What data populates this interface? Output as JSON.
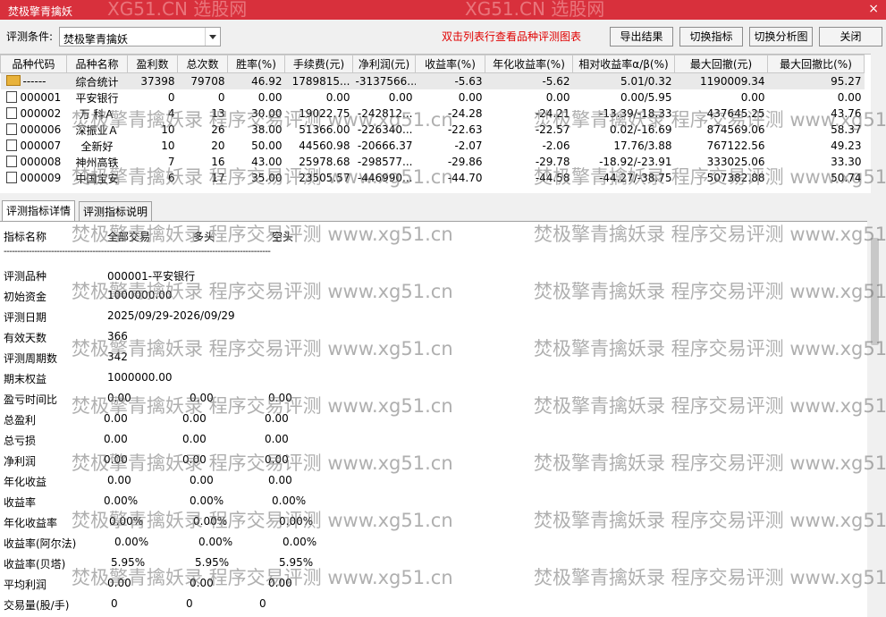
{
  "window": {
    "title": "焚极擎青擒妖",
    "close_label": "×"
  },
  "toolbar": {
    "condition_label": "评测条件:",
    "condition_value": "焚极擎青擒妖",
    "hint": "双击列表行查看品种评测图表",
    "buttons": {
      "export": "导出结果",
      "switch_indicator": "切换指标",
      "switch_chart": "切换分析图",
      "close": "关闭"
    }
  },
  "grid": {
    "columns": [
      "品种代码",
      "品种名称",
      "盈利数",
      "总次数",
      "胜率(%)",
      "手续费(元)",
      "净利润(元)",
      "收益率(%)",
      "年化收益率(%)",
      "相对收益率α/β(%)",
      "最大回撤(元)",
      "最大回撤比(%)"
    ],
    "rows": [
      [
        "------",
        "综合统计",
        "37398",
        "79708",
        "46.92",
        "1789815...",
        "-3137566...",
        "-5.63",
        "-5.62",
        "5.01/0.32",
        "1190009.34",
        "95.27"
      ],
      [
        "000001",
        "平安银行",
        "0",
        "0",
        "0.00",
        "0.00",
        "0.00",
        "0.00",
        "0.00",
        "0.00/5.95",
        "0.00",
        "0.00"
      ],
      [
        "000002",
        "万 科Ａ",
        "4",
        "13",
        "30.00",
        "19022.75",
        "-242812...",
        "-24.28",
        "-24.21",
        "-13.39/-18.33",
        "437645.25",
        "43.76"
      ],
      [
        "000006",
        "深振业Ａ",
        "10",
        "26",
        "38.00",
        "51366.00",
        "-226340...",
        "-22.63",
        "-22.57",
        "0.02/-16.69",
        "874569.06",
        "58.37"
      ],
      [
        "000007",
        "全新好",
        "10",
        "20",
        "50.00",
        "44560.98",
        "-20666.37",
        "-2.07",
        "-2.06",
        "17.76/3.88",
        "767122.56",
        "49.23"
      ],
      [
        "000008",
        "神州高铁",
        "7",
        "16",
        "43.00",
        "25978.68",
        "-298577...",
        "-29.86",
        "-29.78",
        "-18.92/-23.91",
        "333025.06",
        "33.30"
      ],
      [
        "000009",
        "中国宝安",
        "6",
        "17",
        "35.00",
        "23505.57",
        "-446990...",
        "-44.70",
        "-44.58",
        "-44.27/-38.75",
        "507382.88",
        "50.74"
      ]
    ]
  },
  "tabs": [
    "评测指标详情",
    "评测指标说明"
  ],
  "detail": {
    "header": [
      "指标名称",
      "全部交易",
      "多头",
      "空头"
    ],
    "separator": "------------------------------------------------------------------------------------------------",
    "info": [
      [
        "评测品种",
        "000001-平安银行"
      ],
      [
        "初始资金",
        "1000000.00"
      ],
      [
        "评测日期",
        "2025/09/29-2026/09/29"
      ],
      [
        "有效天数",
        "366"
      ],
      [
        "评测周期数",
        "342"
      ],
      [
        "期末权益",
        "1000000.00"
      ]
    ],
    "metrics": [
      [
        "盈亏时间比",
        "0.00",
        "0.00",
        "0.00"
      ],
      [
        "总盈利",
        "0.00",
        "0.00",
        "0.00"
      ],
      [
        "总亏损",
        "0.00",
        "0.00",
        "0.00"
      ],
      [
        "净利润",
        "0.00",
        "0.00",
        "0.00"
      ],
      [
        "年化收益",
        "0.00",
        "0.00",
        "0.00"
      ],
      [
        "收益率",
        "0.00%",
        "0.00%",
        "0.00%"
      ],
      [
        "年化收益率",
        "0.00%",
        "0.00%",
        "0.00%"
      ],
      [
        "收益率(阿尔法)",
        "0.00%",
        "0.00%",
        "0.00%"
      ],
      [
        "收益率(贝塔)",
        "5.95%",
        "5.95%",
        "5.95%"
      ],
      [
        "平均利润",
        "0.00",
        "0.00",
        "0.00"
      ],
      [
        "交易量(股/手)",
        "0",
        "0",
        "0"
      ]
    ]
  },
  "watermark": {
    "text": "焚极擎青擒妖录 程序交易评测 www.xg51.cn",
    "top_text": "XG51.CN 选股网"
  }
}
